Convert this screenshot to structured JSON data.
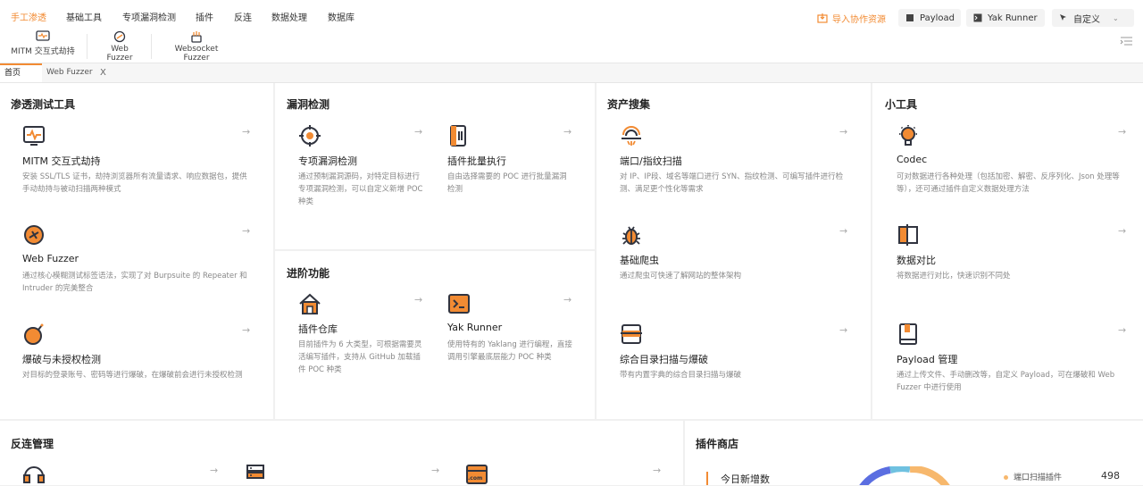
{
  "menu": {
    "items": [
      "手工渗透",
      "基础工具",
      "专项漏洞检测",
      "插件",
      "反连",
      "数据处理",
      "数据库"
    ],
    "import_label": "导入协作资源",
    "payload_label": "Payload",
    "yak_runner_label": "Yak Runner",
    "custom_label": "自定义"
  },
  "toolbar": {
    "mitm": "MITM 交互式劫持",
    "web_fuzzer": "Web Fuzzer",
    "websocket_fuzzer": "Websocket Fuzzer"
  },
  "tabs": {
    "home": "首页",
    "web_fuzzer": "Web Fuzzer",
    "close": "X"
  },
  "sections": {
    "pentest": {
      "title": "渗透测试工具",
      "cards": [
        {
          "title": "MITM 交互式劫持",
          "desc": "安装 SSL/TLS 证书，劫持浏览器所有流量请求、响应数据包，提供手动劫持与被动扫描两种模式"
        },
        {
          "title": "Web Fuzzer",
          "desc": "通过核心模糊测试标签语法，实现了对 Burpsuite 的 Repeater 和 Intruder 的完美整合"
        },
        {
          "title": "爆破与未授权检测",
          "desc": "对目标的登录账号、密码等进行爆破，在爆破前会进行未授权检测"
        }
      ]
    },
    "vuln": {
      "title": "漏洞检测",
      "cards": [
        {
          "title": "专项漏洞检测",
          "desc": "通过预制漏洞源码，对特定目标进行专项漏洞检测，可以自定义新增 POC 种类"
        },
        {
          "title": "插件批量执行",
          "desc": "自由选择需要的 POC 进行批量漏洞检测"
        }
      ]
    },
    "advanced": {
      "title": "进阶功能",
      "cards": [
        {
          "title": "插件仓库",
          "desc": "目前插件为 6 大类型，可根据需要灵活编写插件，支持从 GitHub 加载插件 POC 种类"
        },
        {
          "title": "Yak Runner",
          "desc": "使用特有的 Yaklang 进行编程，直接调用引擎最底层能力 POC 种类"
        }
      ]
    },
    "asset": {
      "title": "资产搜集",
      "cards": [
        {
          "title": "端口/指纹扫描",
          "desc": "对 IP、IP段、域名等端口进行 SYN、指纹检测、可编写插件进行检测、满足更个性化等需求"
        },
        {
          "title": "基础爬虫",
          "desc": "通过爬虫可快速了解网站的整体架构"
        },
        {
          "title": "综合目录扫描与爆破",
          "desc": "带有内置字典的综合目录扫描与爆破"
        }
      ]
    },
    "tools": {
      "title": "小工具",
      "cards": [
        {
          "title": "Codec",
          "desc": "可对数据进行各种处理（包括加密、解密、反序列化、Json 处理等等），还可通过插件自定义数据处理方法"
        },
        {
          "title": "数据对比",
          "desc": "将数据进行对比，快速识别不同处"
        },
        {
          "title": "Payload 管理",
          "desc": "通过上传文件、手动删改等，自定义 Payload，可在爆破和 Web Fuzzer 中进行使用"
        }
      ]
    },
    "reverse": {
      "title": "反连管理",
      "dns_icon_label": ".com"
    },
    "store": {
      "title": "插件商店",
      "today_label": "今日新增数",
      "legend_label": "端口扫描插件",
      "legend_value": "498"
    }
  },
  "arrow": "→",
  "colors": {
    "accent": "#f28b33",
    "icon_dark": "#31343f",
    "text_muted": "#888888"
  }
}
